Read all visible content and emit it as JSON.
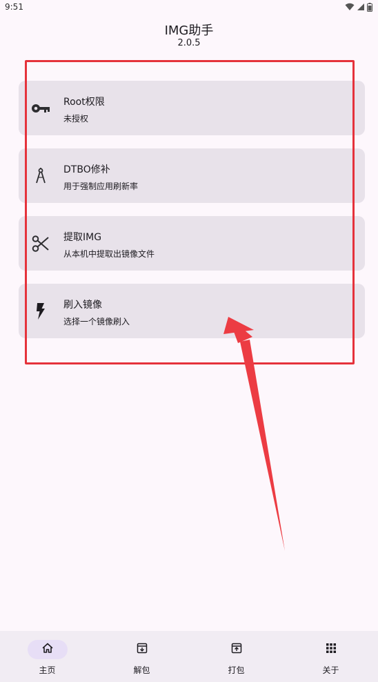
{
  "status_bar": {
    "time": "9:51",
    "icons": [
      "wifi-icon",
      "signal-icon",
      "battery-icon"
    ]
  },
  "header": {
    "title": "IMG助手",
    "version": "2.0.5"
  },
  "cards": [
    {
      "icon": "key-icon",
      "title": "Root权限",
      "subtitle": "未授权"
    },
    {
      "icon": "compass-icon",
      "title": "DTBO修补",
      "subtitle": "用于强制应用刷新率"
    },
    {
      "icon": "scissors-icon",
      "title": "提取IMG",
      "subtitle": "从本机中提取出镜像文件"
    },
    {
      "icon": "flash-icon",
      "title": "刷入镜像",
      "subtitle": "选择一个镜像刷入"
    }
  ],
  "annotation": {
    "color": "#e5323b"
  },
  "nav": {
    "items": [
      {
        "icon": "home-icon",
        "label": "主页",
        "active": true
      },
      {
        "icon": "unpack-icon",
        "label": "解包",
        "active": false
      },
      {
        "icon": "pack-icon",
        "label": "打包",
        "active": false
      },
      {
        "icon": "apps-grid-icon",
        "label": "关于",
        "active": false
      }
    ]
  },
  "colors": {
    "background": "#fdf7fc",
    "card": "#e8e2ea",
    "nav_bar": "#f1ecf3",
    "nav_active_pill": "#e7def6",
    "text": "#1d1b20"
  }
}
